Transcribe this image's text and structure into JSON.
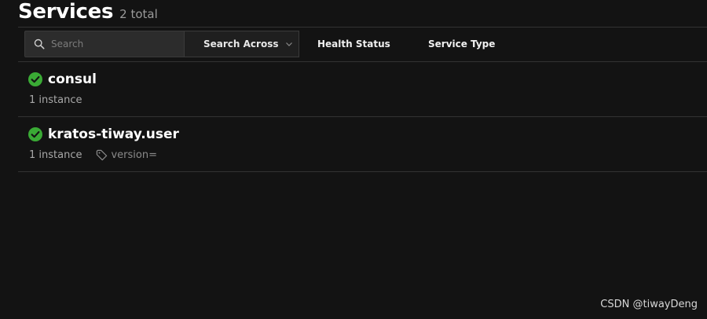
{
  "header": {
    "title": "Services",
    "count": "2 total"
  },
  "filters": {
    "search_placeholder": "Search",
    "search_across_label": "Search Across",
    "health_status_label": "Health Status",
    "service_type_label": "Service Type"
  },
  "services": [
    {
      "name": "consul",
      "instances": "1 instance",
      "status": "passing",
      "tag": ""
    },
    {
      "name": "kratos-tiway.user",
      "instances": "1 instance",
      "status": "passing",
      "tag": "version="
    }
  ],
  "colors": {
    "background": "#131313",
    "passing": "#3aaa35"
  },
  "watermark": "CSDN @tiwayDeng"
}
